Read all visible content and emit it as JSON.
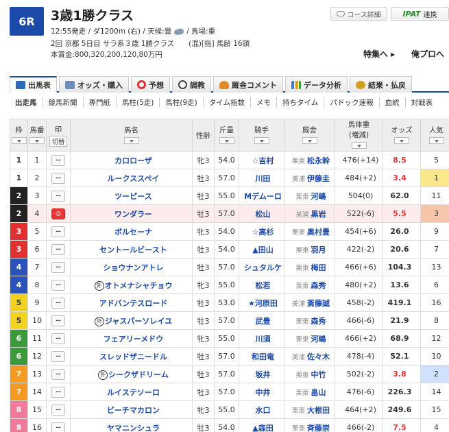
{
  "race": {
    "number": "6R",
    "title": "3歳1勝クラス",
    "line1_pre": "12:55発走 / ダ1200m (右) / 天候:曇",
    "line1_post": "/ 馬場:重",
    "line2": "2回 京都 5日目 サラ系３歳 1勝クラス　　(混)[指] 馬齢 16頭",
    "line3": "本賞金:800,320,200,120,80万円"
  },
  "buttons": {
    "course": "コース詳細",
    "ipat_logo": "IPAT",
    "ipat": "連携",
    "special": "特集へ ▸",
    "ore": "俺プロへ"
  },
  "tabs": [
    {
      "label": "出馬表",
      "color": "#2c6ab8"
    },
    {
      "label": "オッズ・購入",
      "color": "#6b8fb8"
    },
    {
      "label": "予想",
      "color": "#d33"
    },
    {
      "label": "調教",
      "color": "#444"
    },
    {
      "label": "厩舎コメント",
      "color": "#e08a2a"
    },
    {
      "label": "データ分析",
      "color": "#3a7ad0"
    },
    {
      "label": "結果・払戻",
      "color": "#d0a020"
    }
  ],
  "subnav": [
    "出走馬",
    "競馬新聞",
    "専門紙",
    "馬柱(5走)",
    "馬柱(9走)",
    "タイム指数",
    "メモ",
    "持ちタイム",
    "パドック速報",
    "血統",
    "対戦表"
  ],
  "headers": {
    "waku": "枠",
    "umaban": "馬番",
    "mark": "印",
    "kirikae": "切替",
    "name": "馬名",
    "sex": "性齢",
    "kinryo": "斤量",
    "jockey": "騎手",
    "trainer": "厩舎",
    "weight": "馬体重",
    "weight_sub": "(増減)",
    "odds": "オッズ",
    "pop": "人気"
  },
  "waku_colors": {
    "1": {
      "bg": "#ffffff",
      "fg": "#333333"
    },
    "2": {
      "bg": "#222222",
      "fg": "#ffffff"
    },
    "3": {
      "bg": "#e03030",
      "fg": "#ffffff"
    },
    "4": {
      "bg": "#2a52b8",
      "fg": "#ffffff"
    },
    "5": {
      "bg": "#f2d21e",
      "fg": "#333333"
    },
    "6": {
      "bg": "#3a9a3a",
      "fg": "#ffffff"
    },
    "7": {
      "bg": "#f39a22",
      "fg": "#ffffff"
    },
    "8": {
      "bg": "#f07a9a",
      "fg": "#ffffff"
    }
  },
  "mark_default": "--",
  "mark_on": "◎",
  "gai_label": "外",
  "horses": [
    {
      "waku": "1",
      "umaban": "1",
      "name": "カロローザ",
      "gai": false,
      "sex": "牝3",
      "kinryo": "54.0",
      "jockey": "☆吉村",
      "area": "栗東",
      "trainer": "松永幹",
      "weight": "476(+14)",
      "odds": "8.5",
      "odds_red": true,
      "pop": "5",
      "marked": false
    },
    {
      "waku": "1",
      "umaban": "2",
      "name": "ルークススペイ",
      "gai": false,
      "sex": "牡3",
      "kinryo": "57.0",
      "jockey": "川田",
      "area": "美浦",
      "trainer": "伊藤圭",
      "weight": "484(+2)",
      "odds": "3.4",
      "odds_red": true,
      "pop": "1",
      "marked": false
    },
    {
      "waku": "2",
      "umaban": "3",
      "name": "ツーピース",
      "gai": false,
      "sex": "牡3",
      "kinryo": "55.0",
      "jockey": "Mデムーロ",
      "area": "栗東",
      "trainer": "河嶋",
      "weight": "504(0)",
      "odds": "62.0",
      "odds_red": false,
      "pop": "11",
      "marked": false
    },
    {
      "waku": "2",
      "umaban": "4",
      "name": "ワンダラー",
      "gai": false,
      "sex": "牡3",
      "kinryo": "57.0",
      "jockey": "松山",
      "area": "美浦",
      "trainer": "黒岩",
      "weight": "522(-6)",
      "odds": "5.5",
      "odds_red": true,
      "pop": "3",
      "marked": true
    },
    {
      "waku": "3",
      "umaban": "5",
      "name": "ボルセーナ",
      "gai": false,
      "sex": "牝3",
      "kinryo": "54.0",
      "jockey": "☆高杉",
      "area": "栗東",
      "trainer": "奥村豊",
      "weight": "454(+6)",
      "odds": "26.0",
      "odds_red": false,
      "pop": "9",
      "marked": false
    },
    {
      "waku": "3",
      "umaban": "6",
      "name": "セントールビースト",
      "gai": false,
      "sex": "牡3",
      "kinryo": "54.0",
      "jockey": "▲田山",
      "area": "栗東",
      "trainer": "羽月",
      "weight": "422(-2)",
      "odds": "20.6",
      "odds_red": false,
      "pop": "7",
      "marked": false
    },
    {
      "waku": "4",
      "umaban": "7",
      "name": "ショウナンアトレ",
      "gai": false,
      "sex": "牡3",
      "kinryo": "57.0",
      "jockey": "シュタルケ",
      "area": "栗東",
      "trainer": "梅田",
      "weight": "466(+6)",
      "odds": "104.3",
      "odds_red": false,
      "pop": "13",
      "marked": false
    },
    {
      "waku": "4",
      "umaban": "8",
      "name": "オトメナシャチョウ",
      "gai": true,
      "sex": "牝3",
      "kinryo": "55.0",
      "jockey": "松若",
      "area": "栗東",
      "trainer": "森秀",
      "weight": "480(+2)",
      "odds": "13.6",
      "odds_red": false,
      "pop": "6",
      "marked": false
    },
    {
      "waku": "5",
      "umaban": "9",
      "name": "アドバンテスロード",
      "gai": false,
      "sex": "牡3",
      "kinryo": "53.0",
      "jockey": "★河原田",
      "area": "美浦",
      "trainer": "斎藤誠",
      "weight": "458(-2)",
      "odds": "419.1",
      "odds_red": false,
      "pop": "16",
      "marked": false
    },
    {
      "waku": "5",
      "umaban": "10",
      "name": "ジャスパーソレイユ",
      "gai": true,
      "sex": "牡3",
      "kinryo": "57.0",
      "jockey": "武豊",
      "area": "栗東",
      "trainer": "森秀",
      "weight": "466(-6)",
      "odds": "21.9",
      "odds_red": false,
      "pop": "8",
      "marked": false
    },
    {
      "waku": "6",
      "umaban": "11",
      "name": "フェアリーメドウ",
      "gai": false,
      "sex": "牝3",
      "kinryo": "55.0",
      "jockey": "川須",
      "area": "栗東",
      "trainer": "河嶋",
      "weight": "466(+2)",
      "odds": "68.9",
      "odds_red": false,
      "pop": "12",
      "marked": false
    },
    {
      "waku": "6",
      "umaban": "12",
      "name": "スレッドザニードル",
      "gai": false,
      "sex": "牡3",
      "kinryo": "57.0",
      "jockey": "和田竜",
      "area": "美浦",
      "trainer": "佐々木",
      "weight": "478(-4)",
      "odds": "52.1",
      "odds_red": false,
      "pop": "10",
      "marked": false
    },
    {
      "waku": "7",
      "umaban": "13",
      "name": "シークザドリーム",
      "gai": true,
      "sex": "牡3",
      "kinryo": "57.0",
      "jockey": "坂井",
      "area": "栗東",
      "trainer": "中竹",
      "weight": "502(-2)",
      "odds": "3.8",
      "odds_red": true,
      "pop": "2",
      "marked": false
    },
    {
      "waku": "7",
      "umaban": "14",
      "name": "ルイステソーロ",
      "gai": false,
      "sex": "牡3",
      "kinryo": "57.0",
      "jockey": "中井",
      "area": "栗東",
      "trainer": "畠山",
      "weight": "476(-6)",
      "odds": "226.3",
      "odds_red": false,
      "pop": "14",
      "marked": false
    },
    {
      "waku": "8",
      "umaban": "15",
      "name": "ビーチマカロン",
      "gai": false,
      "sex": "牝3",
      "kinryo": "55.0",
      "jockey": "水口",
      "area": "栗東",
      "trainer": "大根田",
      "weight": "464(+2)",
      "odds": "249.6",
      "odds_red": false,
      "pop": "15",
      "marked": false
    },
    {
      "waku": "8",
      "umaban": "16",
      "name": "ヤマニンシュラ",
      "gai": false,
      "sex": "牡3",
      "kinryo": "54.0",
      "jockey": "▲森田",
      "area": "栗東",
      "trainer": "斉藤崇",
      "weight": "466(-2)",
      "odds": "7.5",
      "odds_red": true,
      "pop": "4",
      "marked": false
    }
  ]
}
